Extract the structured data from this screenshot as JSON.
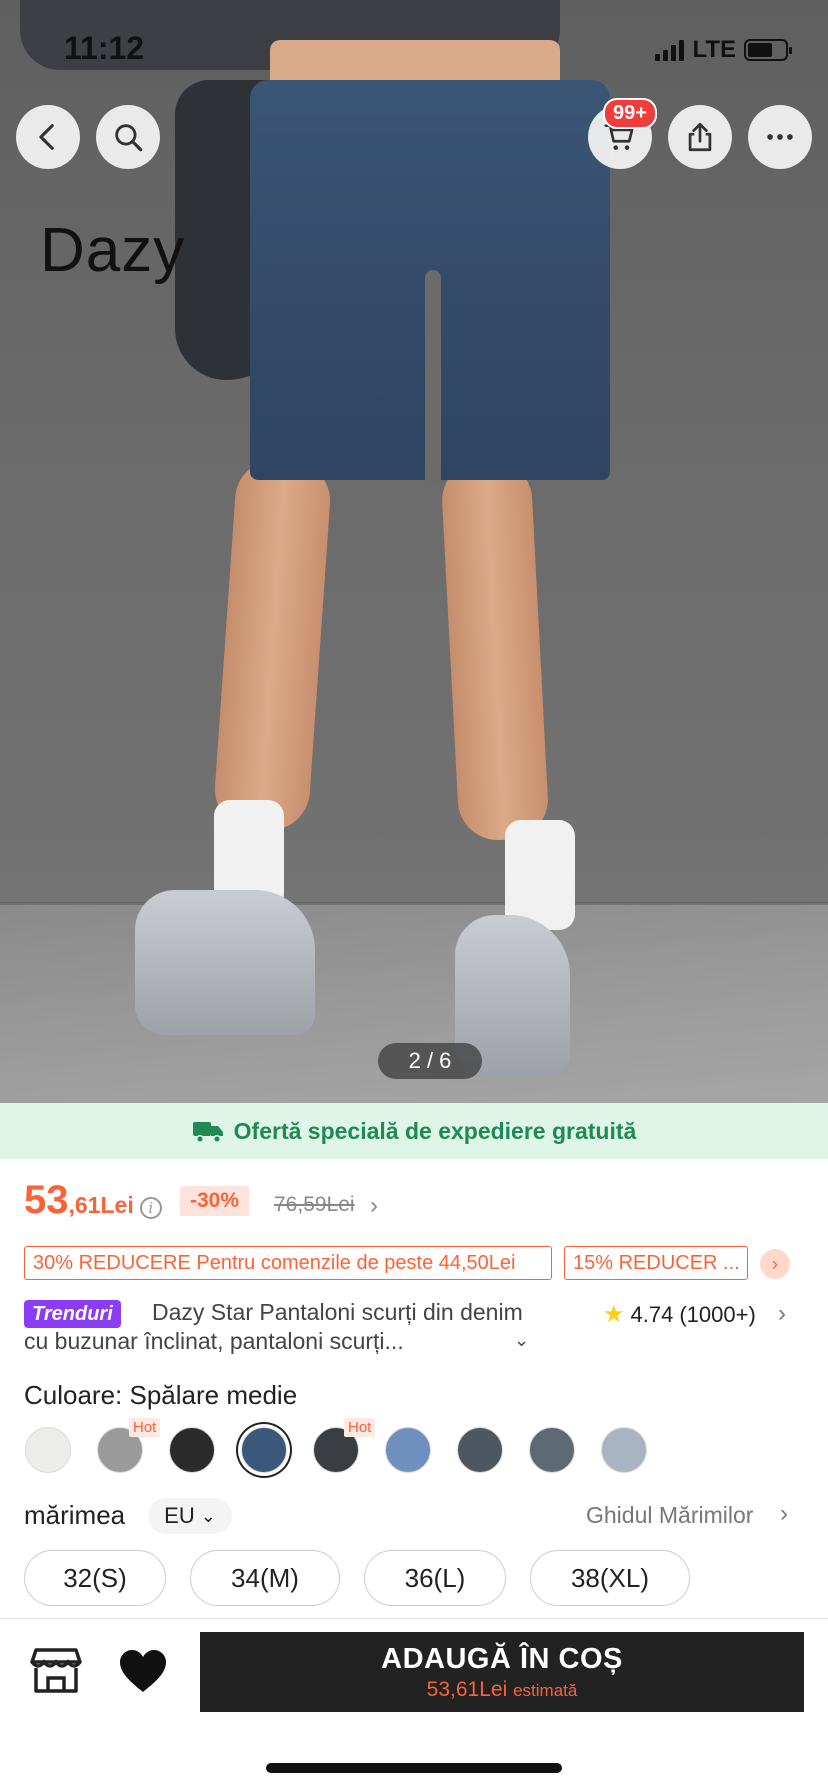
{
  "status_bar": {
    "time": "11:12",
    "network": "LTE"
  },
  "hero": {
    "brand_overlay": "Dazy",
    "counter": "2 / 6",
    "cart_badge": "99+"
  },
  "shipping_banner": {
    "text": "Ofertă specială de expediere gratuită"
  },
  "price": {
    "main": "53",
    "decimals": ",61Lei",
    "discount": "-30%",
    "original": "76,59Lei"
  },
  "coupons": [
    "30% REDUCERE Pentru comenzile de peste 44,50Lei",
    "15% REDUCER ..."
  ],
  "product": {
    "badge": "Trenduri",
    "title": "Dazy Star Pantaloni scurți din denim cu buzunar înclinat, pantaloni scurți...",
    "rating": "4.74",
    "rating_count": "(1000+)"
  },
  "color": {
    "label": "Culoare: Spălare medie",
    "hot_label": "Hot",
    "swatches": [
      "#ececea",
      "#9a9a9a",
      "#2b2b2b",
      "#3b5779",
      "#3a3d42",
      "#6f8fbf",
      "#4e5661",
      "#5e6a73",
      "#a9b4c2"
    ]
  },
  "size": {
    "label": "mărimea",
    "system": "EU",
    "guide": "Ghidul Mărimilor",
    "options": [
      "32(S)",
      "34(M)",
      "36(L)",
      "38(XL)"
    ]
  },
  "bottom_bar": {
    "add_to_cart": "ADAUGĂ ÎN COȘ",
    "estimate_price": "53,61Lei",
    "estimate_label": "estimată"
  },
  "colors": {
    "accent": "#fa6338",
    "banner_green": "#1f8a55",
    "trend_purple": "#8b3cf7"
  }
}
